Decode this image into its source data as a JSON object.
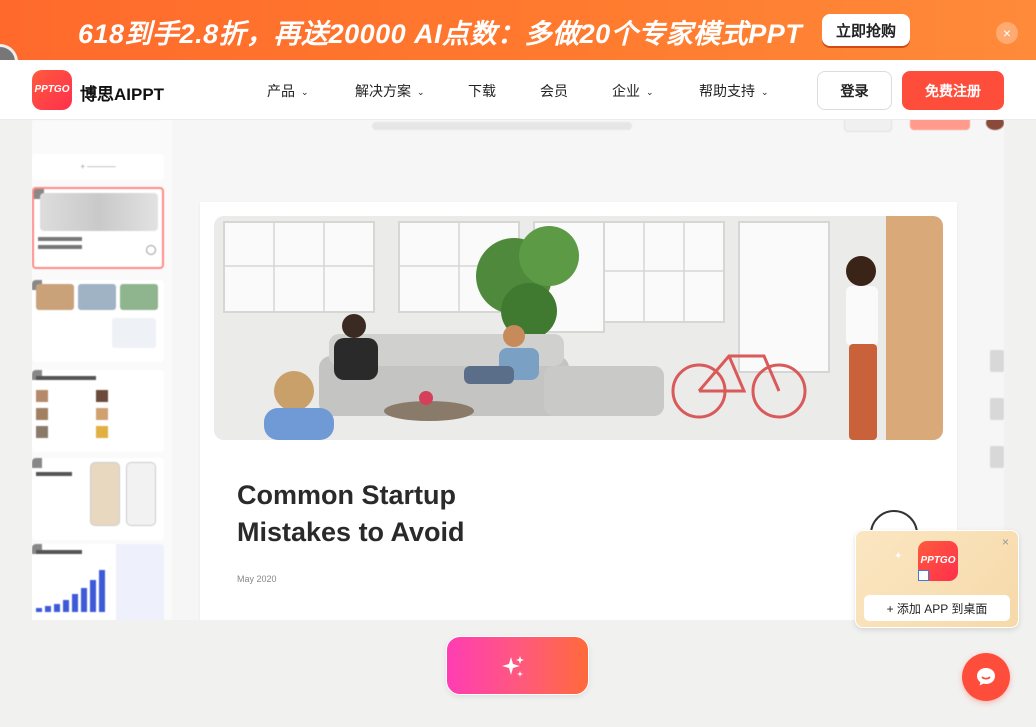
{
  "promo": {
    "text": "618到手2.8折，再送20000 AI点数：多做20个专家模式PPT",
    "cta_label": "立即抢购",
    "close_glyph": "×"
  },
  "navbar": {
    "logo_badge": "PPTGO",
    "brand_name": "博思AIPPT",
    "items": [
      {
        "label": "产品",
        "has_dropdown": true
      },
      {
        "label": "解决方案",
        "has_dropdown": true
      },
      {
        "label": "下载",
        "has_dropdown": false
      },
      {
        "label": "会员",
        "has_dropdown": false
      },
      {
        "label": "企业",
        "has_dropdown": true
      },
      {
        "label": "帮助支持",
        "has_dropdown": true
      }
    ],
    "login_label": "登录",
    "register_label": "免费注册"
  },
  "preview": {
    "slide_title_line1": "Common Startup",
    "slide_title_line2": "Mistakes to Avoid",
    "slide_date": "May 2020"
  },
  "app_card": {
    "logo_badge": "PPTGO",
    "close_glyph": "×",
    "button_label": "+ 添加 APP 到桌面"
  },
  "colors": {
    "promo_orange": "#ff6a2c",
    "brand_red": "#ff4d3c",
    "magic_gradient_start": "#ff3db3",
    "magic_gradient_end": "#ff6a3a"
  },
  "icons": {
    "magic_button": "sparkle-icon",
    "chat_fab": "chat-bubble-icon",
    "nav_dropdown": "chevron-down-icon"
  }
}
